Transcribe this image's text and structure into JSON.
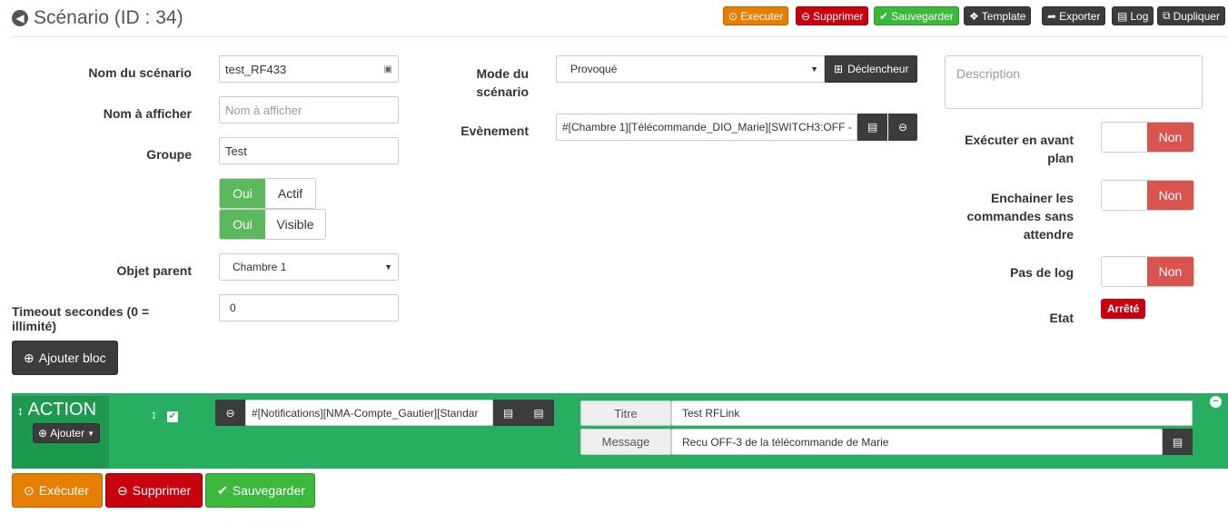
{
  "header": {
    "title": "Scénario (ID : 34)",
    "buttons": {
      "execute": "Executer",
      "delete": "Supprimer",
      "save": "Sauvegarder",
      "template": "Template",
      "export": "Exporter",
      "log": "Log",
      "duplicate": "Dupliquer"
    }
  },
  "form": {
    "name_label": "Nom du scénario",
    "name_value": "test_RF433",
    "display_label": "Nom à afficher",
    "display_placeholder": "Nom à afficher",
    "group_label": "Groupe",
    "group_value": "Test",
    "active_yes": "Oui",
    "active_label": "Actif",
    "visible_yes": "Oui",
    "visible_label": "Visible",
    "parent_label": "Objet parent",
    "parent_value": "Chambre 1",
    "timeout_label": "Timeout secondes (0 = illimité)",
    "timeout_value": "0",
    "mode_label": "Mode du scénario",
    "mode_value": "Provoqué",
    "trigger_button": "Déclencheur",
    "event_label": "Evènement",
    "event_value": "#[Chambre 1][Télécommande_DIO_Marie][SWITCH3:OFF -",
    "description_placeholder": "Description",
    "foreground_label": "Exécuter en avant plan",
    "foreground_value": "Non",
    "chain_label": "Enchainer les commandes sans attendre",
    "chain_value": "Non",
    "nolog_label": "Pas de log",
    "nolog_value": "Non",
    "state_label": "Etat",
    "state_value": "Arrêté"
  },
  "add_block": "Ajouter bloc",
  "action_block": {
    "title": "ACTION",
    "add_button": "Ajouter",
    "command": "#[Notifications][NMA-Compte_Gautier][Standar",
    "title_label": "Titre",
    "title_value": "Test RFLink",
    "message_label": "Message",
    "message_value": "Recu OFF-3 de la télécommande de Marie"
  },
  "footer": {
    "execute": "Exécuter",
    "delete": "Supprimer",
    "save": "Sauvegarder"
  },
  "colors": {
    "execute": "#e67e00",
    "delete": "#c9000e",
    "save": "#3cb83c",
    "action_bg": "#27ae60",
    "no": "#d9534f",
    "yes": "#5cb85c"
  }
}
